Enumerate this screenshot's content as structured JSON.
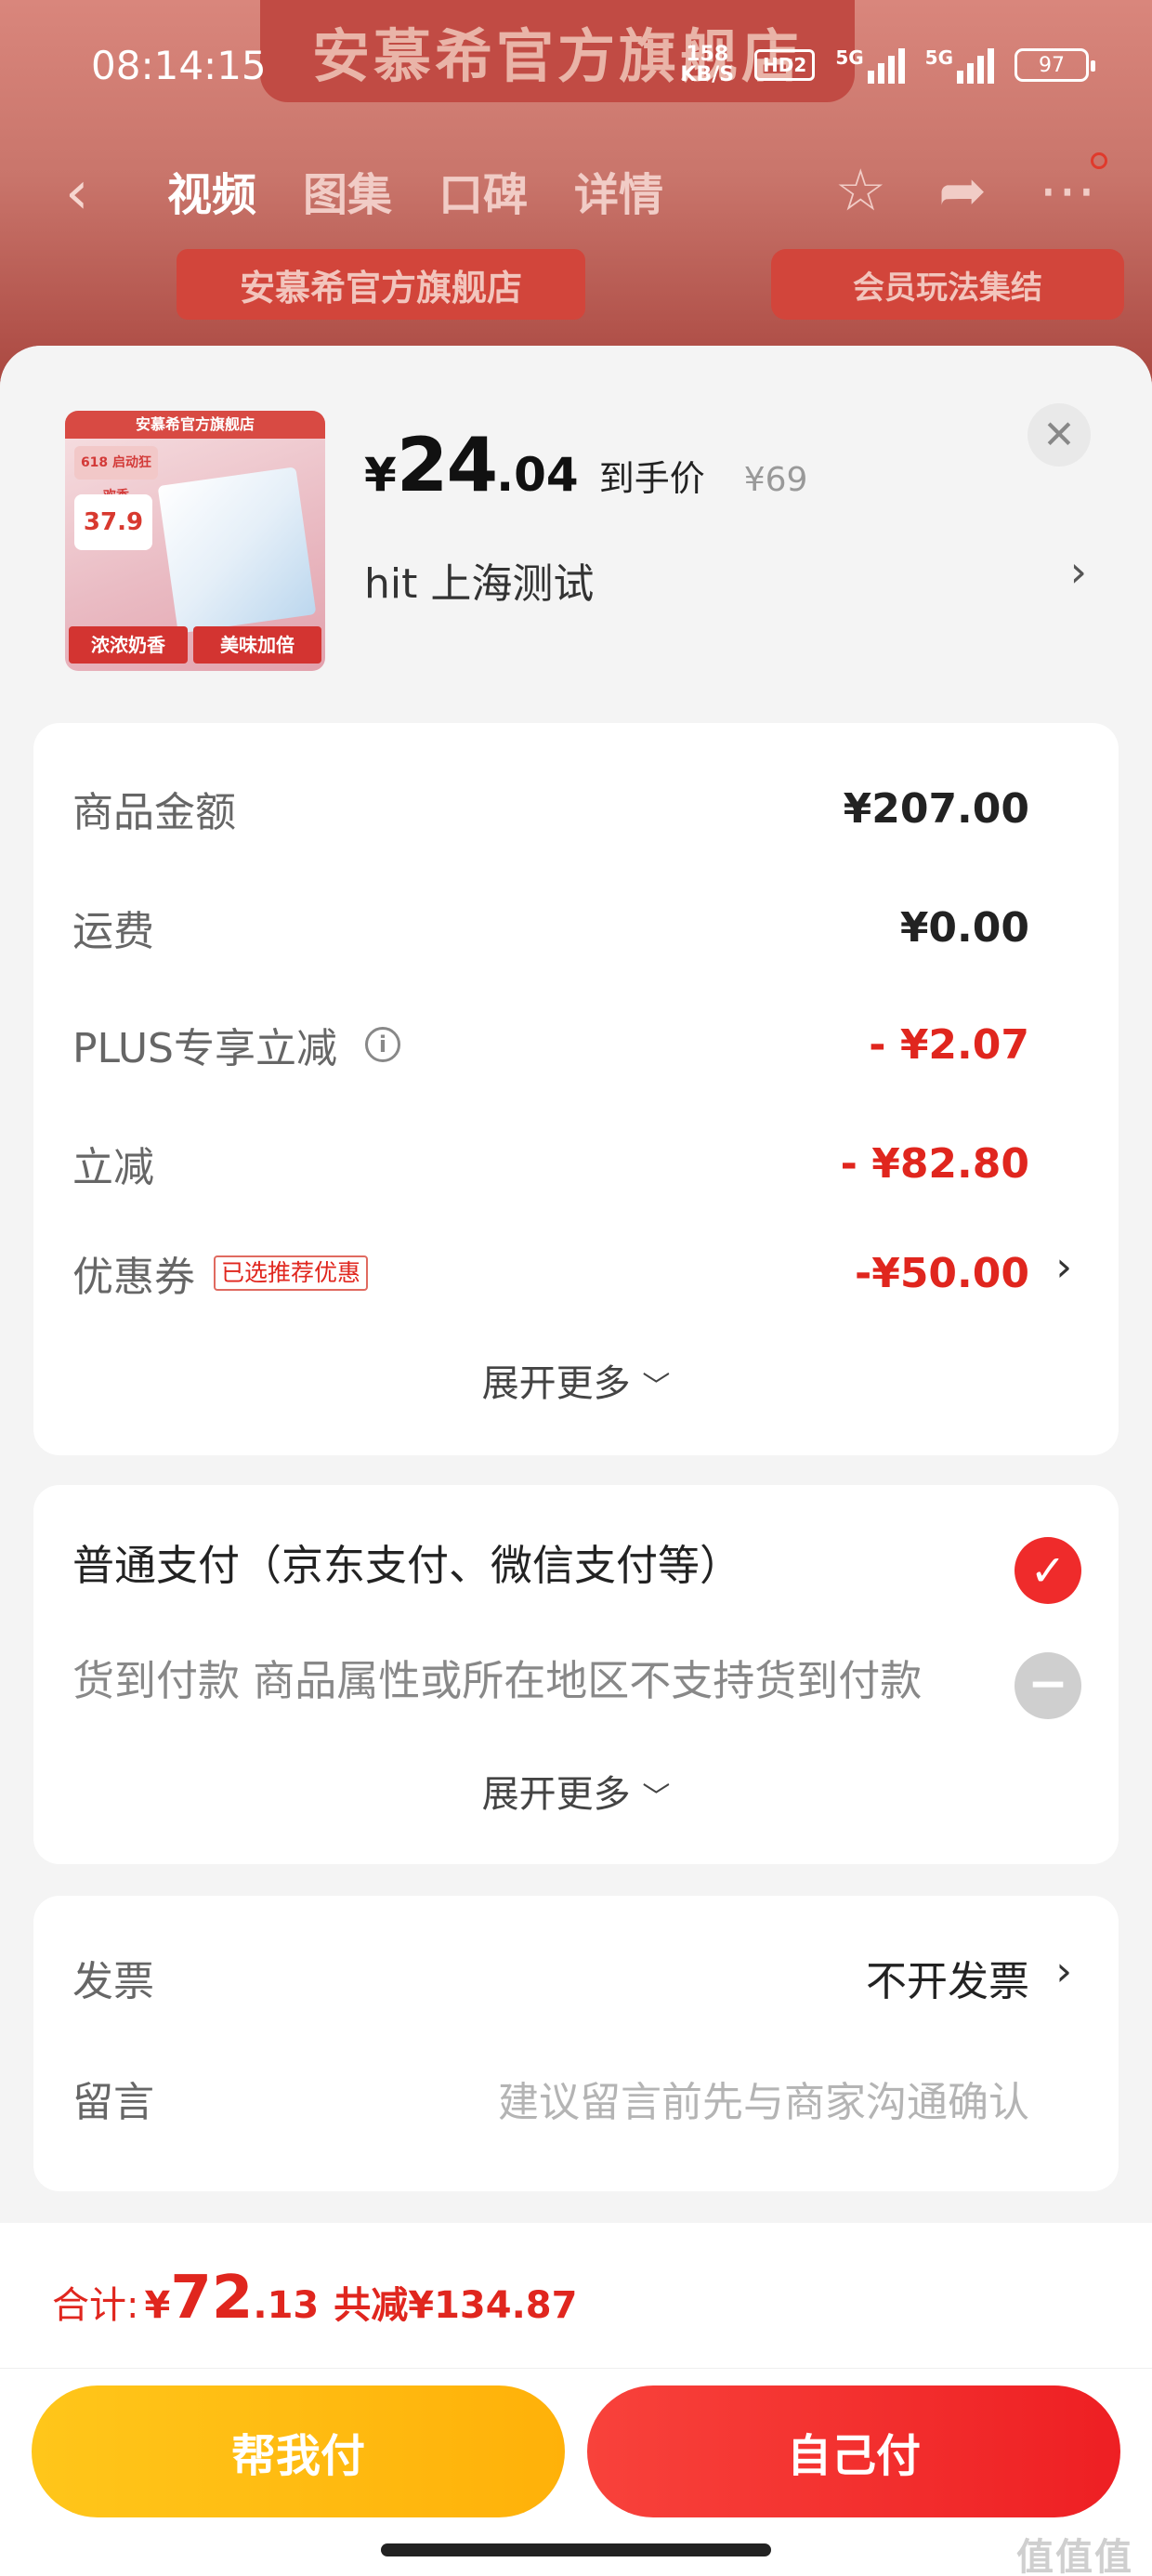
{
  "status_bar": {
    "time": "08:14:15",
    "net_speed": "158",
    "net_unit": "KB/S",
    "hd": "HD2",
    "signal1": "5G",
    "signal2": "5G",
    "battery": "97"
  },
  "background": {
    "banner_top": "安慕希官方旗舰店",
    "store_banner": "安慕希官方旗舰店",
    "member_banner": "会员玩法集结",
    "nav_tabs": [
      "视频",
      "图集",
      "口碑",
      "详情"
    ]
  },
  "product": {
    "thumb_store": "安慕希官方旗舰店",
    "thumb_badge": "618 启动狂欢季",
    "thumb_price": "37.9",
    "thumb_tag1": "浓浓奶香",
    "thumb_tag2": "美味加倍",
    "price_yen": "¥",
    "price_int": "24",
    "price_dec": ".04",
    "price_label": "到手价",
    "original_price": "¥69",
    "address": "hit  上海测试"
  },
  "amounts": {
    "goods_label": "商品金额",
    "goods_value": "¥207.00",
    "shipping_label": "运费",
    "shipping_value": "¥0.00",
    "plus_label": "PLUS专享立减",
    "plus_value": "- ¥2.07",
    "discount_label": "立减",
    "discount_value": "- ¥82.80",
    "coupon_label": "优惠券",
    "coupon_tag": "已选推荐优惠",
    "coupon_value": "-¥50.00",
    "expand_more": "展开更多"
  },
  "payment": {
    "normal_pay": "普通支付（京东支付、微信支付等）",
    "cod_pay": "货到付款 商品属性或所在地区不支持货到付款",
    "expand_more": "展开更多"
  },
  "invoice": {
    "invoice_label": "发票",
    "invoice_value": "不开发票",
    "note_label": "留言",
    "note_placeholder": "建议留言前先与商家沟通确认"
  },
  "total": {
    "label": "合计:",
    "yen": "¥",
    "int": "72",
    "dec": ".13",
    "saved": "共减¥134.87"
  },
  "actions": {
    "help_pay": "帮我付",
    "self_pay": "自己付"
  },
  "watermark": "值值值",
  "colors": {
    "accent_red": "#e0261e",
    "yellow_button": "#ffb109",
    "red_button": "#ee1f23"
  }
}
